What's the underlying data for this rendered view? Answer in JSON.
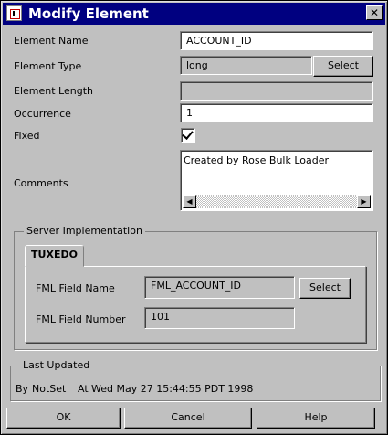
{
  "window": {
    "title": "Modify Element"
  },
  "form": {
    "element_name_label": "Element Name",
    "element_name_value": "ACCOUNT_ID",
    "element_type_label": "Element Type",
    "element_type_value": "long",
    "element_type_select": "Select",
    "element_length_label": "Element Length",
    "element_length_value": "",
    "occurrence_label": "Occurrence",
    "occurrence_value": "1",
    "fixed_label": "Fixed",
    "fixed_checked": true,
    "comments_label": "Comments",
    "comments_value": "Created by Rose Bulk Loader"
  },
  "server": {
    "group_title": "Server Implementation",
    "tab_label": "TUXEDO",
    "fml_name_label": "FML Field Name",
    "fml_name_value": "FML_ACCOUNT_ID",
    "fml_select": "Select",
    "fml_number_label": "FML Field Number",
    "fml_number_value": "101"
  },
  "last_updated": {
    "group_title": "Last Updated",
    "by_label": "By",
    "by_value": "NotSet",
    "at_label": "At",
    "at_value": "Wed May 27 15:44:55 PDT 1998"
  },
  "buttons": {
    "ok": "OK",
    "cancel": "Cancel",
    "help": "Help"
  },
  "icons": [
    "app-icon",
    "close-icon",
    "scroll-left-icon",
    "scroll-right-icon",
    "checkmark-icon"
  ]
}
